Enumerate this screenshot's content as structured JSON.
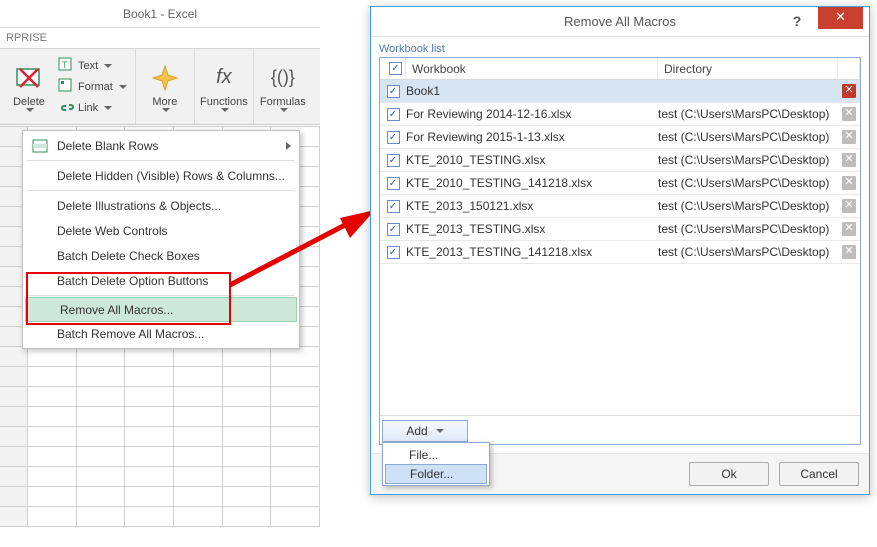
{
  "excel": {
    "window_title": "Book1 - Excel",
    "ribbon_tab_fragment": "RPRISE",
    "groups": {
      "delete": {
        "label": "Delete"
      },
      "text": {
        "label": "Text"
      },
      "format": {
        "label": "Format"
      },
      "link": {
        "label": "Link"
      },
      "more": {
        "label": "More"
      },
      "functions": {
        "label": "Functions",
        "glyph": "fx"
      },
      "formulas": {
        "label": "Formulas",
        "glyph": "{()}"
      }
    }
  },
  "delete_menu": {
    "items": [
      {
        "label": "Delete Blank Rows",
        "has_submenu": true
      },
      {
        "label": "Delete Hidden (Visible) Rows & Columns..."
      },
      {
        "label": "Delete Illustrations & Objects..."
      },
      {
        "label": "Delete Web Controls"
      },
      {
        "label": "Batch Delete Check Boxes"
      },
      {
        "label": "Batch Delete Option Buttons"
      },
      {
        "label": "Remove All Macros...",
        "highlighted": true
      },
      {
        "label": "Batch Remove All Macros..."
      }
    ]
  },
  "dialog": {
    "title": "Remove All Macros",
    "group_label": "Workbook list",
    "columns": {
      "workbook": "Workbook",
      "directory": "Directory"
    },
    "rows": [
      {
        "checked": true,
        "workbook": "Book1",
        "directory": "",
        "selected": true,
        "close_red": true
      },
      {
        "checked": true,
        "workbook": "For Reviewing 2014-12-16.xlsx",
        "directory": "test (C:\\Users\\MarsPC\\Desktop)"
      },
      {
        "checked": true,
        "workbook": "For Reviewing 2015-1-13.xlsx",
        "directory": "test (C:\\Users\\MarsPC\\Desktop)"
      },
      {
        "checked": true,
        "workbook": "KTE_2010_TESTING.xlsx",
        "directory": "test (C:\\Users\\MarsPC\\Desktop)"
      },
      {
        "checked": true,
        "workbook": "KTE_2010_TESTING_141218.xlsx",
        "directory": "test (C:\\Users\\MarsPC\\Desktop)"
      },
      {
        "checked": true,
        "workbook": "KTE_2013_150121.xlsx",
        "directory": "test (C:\\Users\\MarsPC\\Desktop)"
      },
      {
        "checked": true,
        "workbook": "KTE_2013_TESTING.xlsx",
        "directory": "test (C:\\Users\\MarsPC\\Desktop)"
      },
      {
        "checked": true,
        "workbook": "KTE_2013_TESTING_141218.xlsx",
        "directory": "test (C:\\Users\\MarsPC\\Desktop)"
      }
    ],
    "add_button": "Add",
    "add_menu": {
      "file": "File...",
      "folder": "Folder..."
    },
    "ok": "Ok",
    "cancel": "Cancel",
    "help_glyph": "?",
    "close_glyph": "✕"
  }
}
